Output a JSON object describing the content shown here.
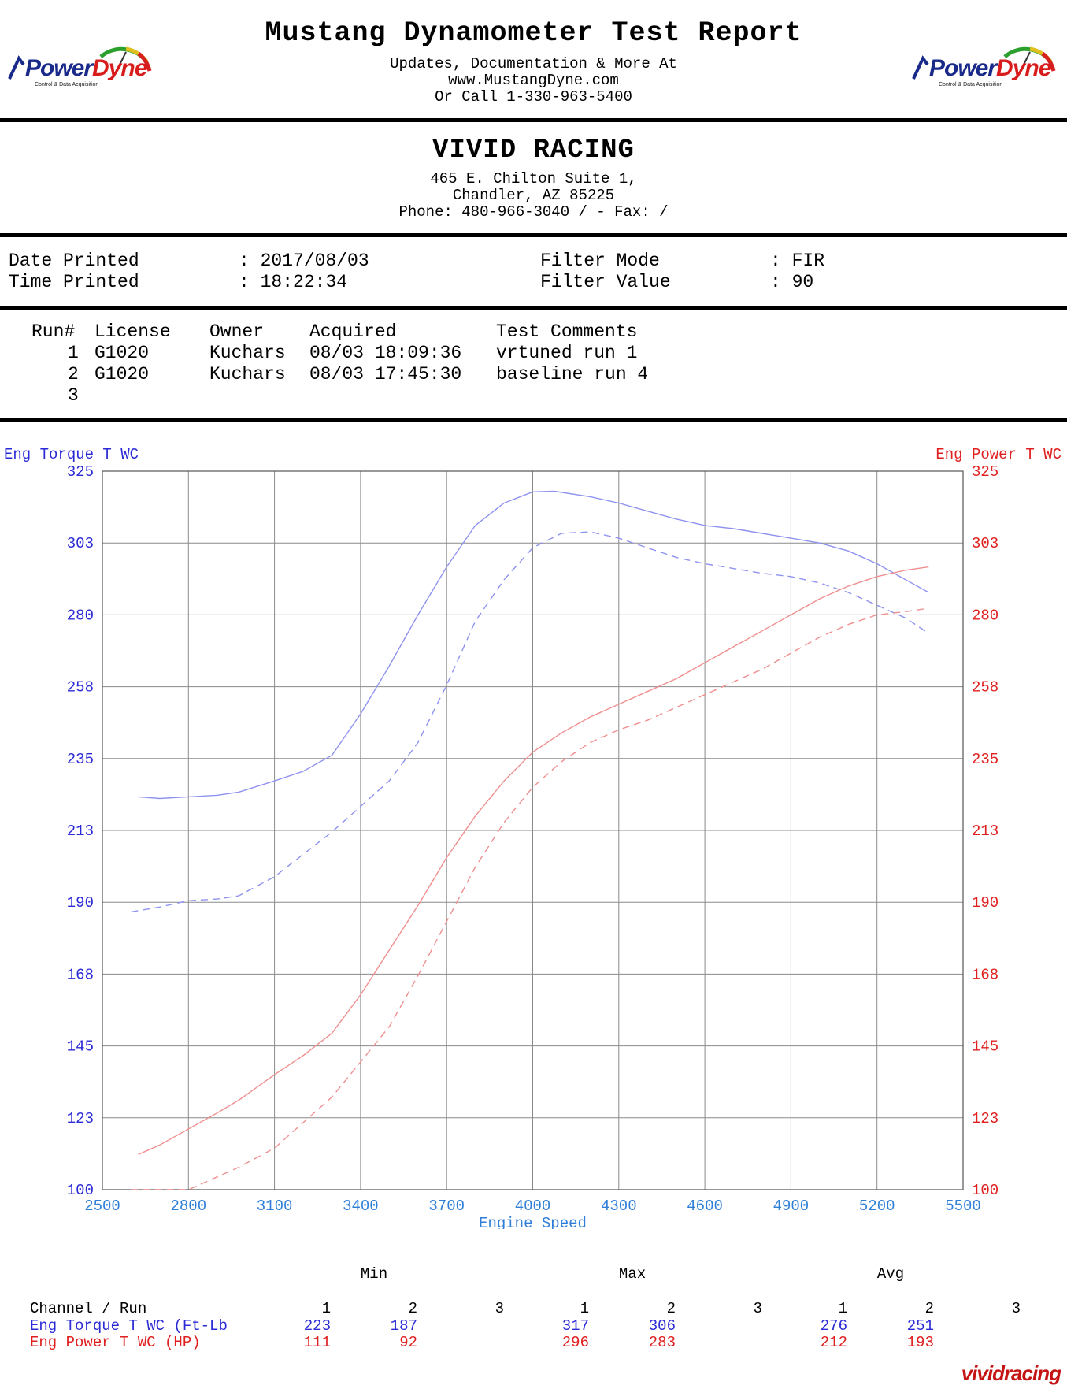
{
  "header": {
    "title": "Mustang Dynamometer Test Report",
    "line1": "Updates, Documentation & More At",
    "line2": "www.MustangDyne.com",
    "line3": "Or Call 1-330-963-5400",
    "logo_power": "Power",
    "logo_dyne": "Dyne",
    "logo_tag": "Control & Data Acquisition"
  },
  "shop": {
    "name": "VIVID RACING",
    "address1": "465 E. Chilton Suite 1,",
    "address2": "Chandler, AZ  85225",
    "phone": "Phone: 480-966-3040 /  - Fax:  /"
  },
  "print_info": {
    "date_label": "Date Printed",
    "date_value": ": 2017/08/03",
    "time_label": "Time Printed",
    "time_value": ": 18:22:34",
    "filter_mode_label": "Filter Mode",
    "filter_mode_value": ": FIR",
    "filter_value_label": "Filter Value",
    "filter_value_value": ": 90"
  },
  "runs": {
    "headers": [
      "Run#",
      "License",
      "Owner",
      "Acquired",
      "Test Comments"
    ],
    "rows": [
      {
        "run": "1",
        "license": "G1020",
        "owner": "Kuchars",
        "acquired": "08/03 18:09:36",
        "comment": "vrtuned run 1"
      },
      {
        "run": "2",
        "license": "G1020",
        "owner": "Kuchars",
        "acquired": "08/03 17:45:30",
        "comment": "baseline run 4"
      },
      {
        "run": "3",
        "license": "",
        "owner": "",
        "acquired": "",
        "comment": ""
      }
    ]
  },
  "chart_data": {
    "type": "line",
    "xlabel": "Engine Speed",
    "ylabel_left": "Eng Torque T WC",
    "ylabel_right": "Eng Power T WC",
    "xlim": [
      2500,
      5500
    ],
    "ylim": [
      100,
      325
    ],
    "x_ticks": [
      "2500",
      "2800",
      "3100",
      "3400",
      "3700",
      "4000",
      "4300",
      "4600",
      "4900",
      "5200",
      "5500"
    ],
    "y_ticks": [
      "100",
      "123",
      "145",
      "168",
      "190",
      "213",
      "235",
      "258",
      "280",
      "303",
      "325"
    ],
    "grid": true,
    "colors": {
      "torque": "#8f93f0",
      "power": "#f08f8f",
      "torque_text": "#2b2bd6",
      "power_text": "#e02020",
      "axis_text": "#2f7fd8"
    },
    "series": [
      {
        "channel": "Eng Torque T WC",
        "run": "1",
        "style": "solid",
        "x": [
          2625,
          2700,
          2800,
          2900,
          2975,
          3100,
          3200,
          3300,
          3400,
          3500,
          3600,
          3700,
          3800,
          3900,
          4000,
          4075,
          4200,
          4300,
          4400,
          4500,
          4600,
          4700,
          4800,
          4900,
          5000,
          5100,
          5200,
          5300,
          5380
        ],
        "y": [
          223,
          222.5,
          223,
          223.5,
          224.5,
          228,
          231,
          236,
          249,
          264,
          280,
          295,
          308,
          315,
          318.5,
          318.7,
          317,
          315,
          312.5,
          310,
          308,
          307,
          305.5,
          304,
          302.5,
          300,
          296,
          291,
          287
        ]
      },
      {
        "channel": "Eng Torque T WC",
        "run": "2",
        "style": "dashed",
        "x": [
          2600,
          2700,
          2800,
          2900,
          2975,
          3100,
          3200,
          3300,
          3400,
          3500,
          3600,
          3700,
          3800,
          3900,
          4000,
          4100,
          4200,
          4300,
          4400,
          4500,
          4600,
          4700,
          4800,
          4900,
          5000,
          5100,
          5200,
          5300,
          5375
        ],
        "y": [
          187,
          188.5,
          190.5,
          191,
          192,
          198,
          205,
          212,
          220,
          228,
          240,
          258,
          278,
          291,
          301,
          305.5,
          306,
          304,
          301,
          298,
          296,
          294.5,
          293,
          292,
          290,
          287,
          283,
          279,
          274.5
        ]
      },
      {
        "channel": "Eng Power T WC",
        "run": "1",
        "style": "solid",
        "x": [
          2625,
          2700,
          2800,
          2900,
          2975,
          3100,
          3200,
          3300,
          3400,
          3500,
          3600,
          3700,
          3800,
          3900,
          4000,
          4100,
          4200,
          4300,
          4400,
          4500,
          4600,
          4700,
          4800,
          4900,
          5000,
          5100,
          5200,
          5300,
          5380
        ],
        "y": [
          111,
          114,
          119,
          124,
          128,
          136,
          142,
          149,
          161,
          175,
          189,
          204,
          217,
          228,
          237,
          243,
          248,
          252,
          256,
          260,
          265,
          270,
          275,
          280,
          285,
          289,
          292,
          294,
          295
        ]
      },
      {
        "channel": "Eng Power T WC",
        "run": "2",
        "style": "dashed",
        "x": [
          2600,
          2700,
          2800,
          2900,
          2975,
          3100,
          3200,
          3300,
          3400,
          3500,
          3600,
          3700,
          3800,
          3900,
          4000,
          4100,
          4200,
          4300,
          4400,
          4500,
          4600,
          4700,
          4800,
          4900,
          5000,
          5100,
          5200,
          5300,
          5375
        ],
        "y": [
          100,
          100,
          100,
          104,
          107,
          113,
          121,
          129,
          140,
          151,
          167,
          184,
          201,
          215,
          226,
          234,
          240,
          244,
          247,
          251,
          255,
          259,
          263,
          268,
          273,
          277,
          280,
          281,
          282
        ]
      }
    ]
  },
  "stats": {
    "groups": [
      "Min",
      "Max",
      "Avg"
    ],
    "channel_header": "Channel / Run",
    "run_headers": [
      "1",
      "2",
      "3"
    ],
    "rows": [
      {
        "channel": "Eng Torque T WC (Ft-Lb",
        "min": [
          "223",
          "187",
          ""
        ],
        "max": [
          "317",
          "306",
          ""
        ],
        "avg": [
          "276",
          "251",
          ""
        ]
      },
      {
        "channel": "Eng Power T WC (HP)",
        "min": [
          "111",
          "92",
          ""
        ],
        "max": [
          "296",
          "283",
          ""
        ],
        "avg": [
          "212",
          "193",
          ""
        ]
      }
    ]
  },
  "watermark": "vividracing"
}
